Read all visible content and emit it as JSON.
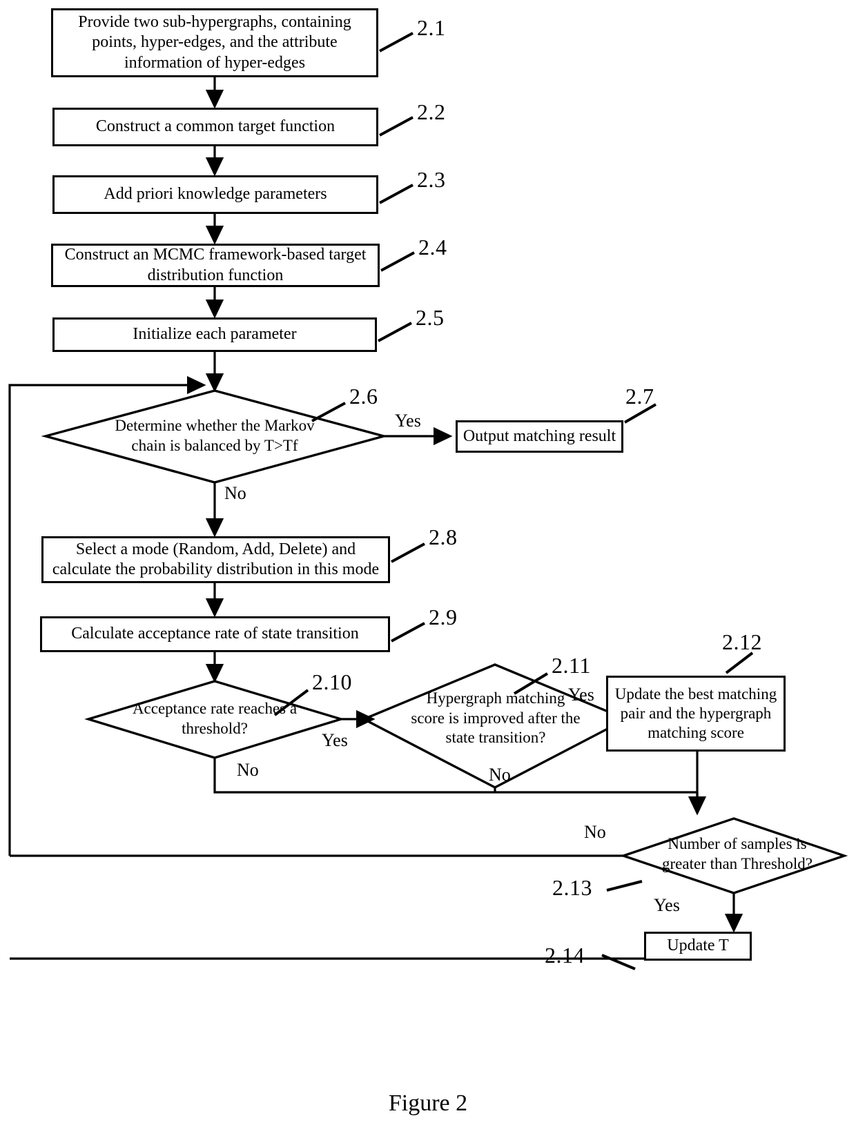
{
  "figure": {
    "caption": "Figure 2"
  },
  "nodes": [
    {
      "id": "2.1",
      "type": "process",
      "text": "Provide two sub-hypergraphs, containing points, hyper-edges, and the attribute information of hyper-edges",
      "ref": "2.1"
    },
    {
      "id": "2.2",
      "type": "process",
      "text": "Construct a common target function",
      "ref": "2.2"
    },
    {
      "id": "2.3",
      "type": "process",
      "text": "Add priori knowledge parameters",
      "ref": "2.3"
    },
    {
      "id": "2.4",
      "type": "process",
      "text": "Construct an MCMC framework-based target distribution function",
      "ref": "2.4"
    },
    {
      "id": "2.5",
      "type": "process",
      "text": "Initialize each parameter",
      "ref": "2.5"
    },
    {
      "id": "2.6",
      "type": "decision",
      "text": "Determine whether the Markov chain is balanced by T>Tf",
      "ref": "2.6"
    },
    {
      "id": "2.7",
      "type": "process",
      "text": "Output matching result",
      "ref": "2.7"
    },
    {
      "id": "2.8",
      "type": "process",
      "text": "Select a mode (Random, Add, Delete) and calculate the probability distribution in this mode",
      "ref": "2.8"
    },
    {
      "id": "2.9",
      "type": "process",
      "text": "Calculate acceptance rate of state transition",
      "ref": "2.9"
    },
    {
      "id": "2.10",
      "type": "decision",
      "text": "Acceptance rate reaches a threshold?",
      "ref": "2.10"
    },
    {
      "id": "2.11",
      "type": "decision",
      "text": "Hypergraph matching score is improved after the state transition?",
      "ref": "2.11"
    },
    {
      "id": "2.12",
      "type": "process",
      "text": "Update the best matching pair and the hypergraph matching score",
      "ref": "2.12"
    },
    {
      "id": "2.13",
      "type": "decision",
      "text": "Number of samples is greater than Threshold?",
      "ref": "2.13"
    },
    {
      "id": "2.14",
      "type": "process",
      "text": "Update T",
      "ref": "2.14"
    }
  ],
  "edge_labels": {
    "d26_yes": "Yes",
    "d26_no": "No",
    "d210_yes": "Yes",
    "d210_no": "No",
    "d211_no": "No",
    "d211_yes": "Yes",
    "d213_no": "No",
    "d213_yes": "Yes"
  }
}
